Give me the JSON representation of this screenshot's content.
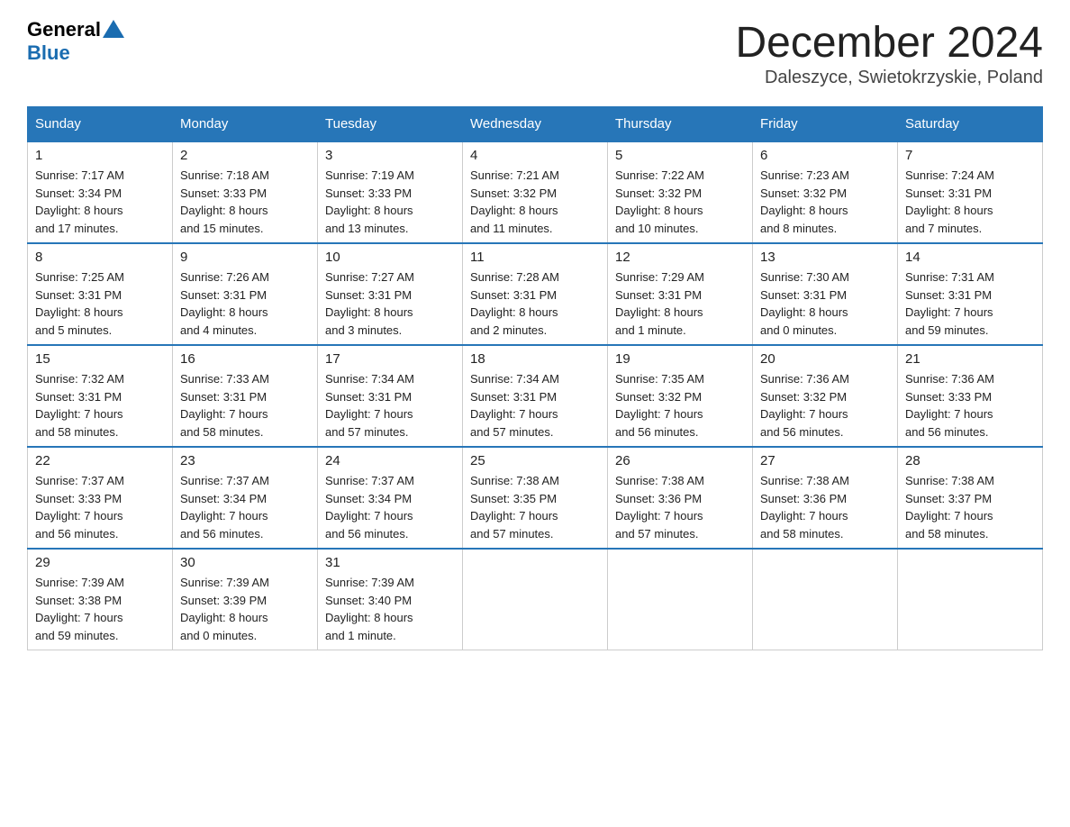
{
  "header": {
    "logo_general": "General",
    "logo_blue": "Blue",
    "title": "December 2024",
    "subtitle": "Daleszyce, Swietokrzyskie, Poland"
  },
  "weekdays": [
    "Sunday",
    "Monday",
    "Tuesday",
    "Wednesday",
    "Thursday",
    "Friday",
    "Saturday"
  ],
  "weeks": [
    [
      {
        "day": "1",
        "info": "Sunrise: 7:17 AM\nSunset: 3:34 PM\nDaylight: 8 hours\nand 17 minutes."
      },
      {
        "day": "2",
        "info": "Sunrise: 7:18 AM\nSunset: 3:33 PM\nDaylight: 8 hours\nand 15 minutes."
      },
      {
        "day": "3",
        "info": "Sunrise: 7:19 AM\nSunset: 3:33 PM\nDaylight: 8 hours\nand 13 minutes."
      },
      {
        "day": "4",
        "info": "Sunrise: 7:21 AM\nSunset: 3:32 PM\nDaylight: 8 hours\nand 11 minutes."
      },
      {
        "day": "5",
        "info": "Sunrise: 7:22 AM\nSunset: 3:32 PM\nDaylight: 8 hours\nand 10 minutes."
      },
      {
        "day": "6",
        "info": "Sunrise: 7:23 AM\nSunset: 3:32 PM\nDaylight: 8 hours\nand 8 minutes."
      },
      {
        "day": "7",
        "info": "Sunrise: 7:24 AM\nSunset: 3:31 PM\nDaylight: 8 hours\nand 7 minutes."
      }
    ],
    [
      {
        "day": "8",
        "info": "Sunrise: 7:25 AM\nSunset: 3:31 PM\nDaylight: 8 hours\nand 5 minutes."
      },
      {
        "day": "9",
        "info": "Sunrise: 7:26 AM\nSunset: 3:31 PM\nDaylight: 8 hours\nand 4 minutes."
      },
      {
        "day": "10",
        "info": "Sunrise: 7:27 AM\nSunset: 3:31 PM\nDaylight: 8 hours\nand 3 minutes."
      },
      {
        "day": "11",
        "info": "Sunrise: 7:28 AM\nSunset: 3:31 PM\nDaylight: 8 hours\nand 2 minutes."
      },
      {
        "day": "12",
        "info": "Sunrise: 7:29 AM\nSunset: 3:31 PM\nDaylight: 8 hours\nand 1 minute."
      },
      {
        "day": "13",
        "info": "Sunrise: 7:30 AM\nSunset: 3:31 PM\nDaylight: 8 hours\nand 0 minutes."
      },
      {
        "day": "14",
        "info": "Sunrise: 7:31 AM\nSunset: 3:31 PM\nDaylight: 7 hours\nand 59 minutes."
      }
    ],
    [
      {
        "day": "15",
        "info": "Sunrise: 7:32 AM\nSunset: 3:31 PM\nDaylight: 7 hours\nand 58 minutes."
      },
      {
        "day": "16",
        "info": "Sunrise: 7:33 AM\nSunset: 3:31 PM\nDaylight: 7 hours\nand 58 minutes."
      },
      {
        "day": "17",
        "info": "Sunrise: 7:34 AM\nSunset: 3:31 PM\nDaylight: 7 hours\nand 57 minutes."
      },
      {
        "day": "18",
        "info": "Sunrise: 7:34 AM\nSunset: 3:31 PM\nDaylight: 7 hours\nand 57 minutes."
      },
      {
        "day": "19",
        "info": "Sunrise: 7:35 AM\nSunset: 3:32 PM\nDaylight: 7 hours\nand 56 minutes."
      },
      {
        "day": "20",
        "info": "Sunrise: 7:36 AM\nSunset: 3:32 PM\nDaylight: 7 hours\nand 56 minutes."
      },
      {
        "day": "21",
        "info": "Sunrise: 7:36 AM\nSunset: 3:33 PM\nDaylight: 7 hours\nand 56 minutes."
      }
    ],
    [
      {
        "day": "22",
        "info": "Sunrise: 7:37 AM\nSunset: 3:33 PM\nDaylight: 7 hours\nand 56 minutes."
      },
      {
        "day": "23",
        "info": "Sunrise: 7:37 AM\nSunset: 3:34 PM\nDaylight: 7 hours\nand 56 minutes."
      },
      {
        "day": "24",
        "info": "Sunrise: 7:37 AM\nSunset: 3:34 PM\nDaylight: 7 hours\nand 56 minutes."
      },
      {
        "day": "25",
        "info": "Sunrise: 7:38 AM\nSunset: 3:35 PM\nDaylight: 7 hours\nand 57 minutes."
      },
      {
        "day": "26",
        "info": "Sunrise: 7:38 AM\nSunset: 3:36 PM\nDaylight: 7 hours\nand 57 minutes."
      },
      {
        "day": "27",
        "info": "Sunrise: 7:38 AM\nSunset: 3:36 PM\nDaylight: 7 hours\nand 58 minutes."
      },
      {
        "day": "28",
        "info": "Sunrise: 7:38 AM\nSunset: 3:37 PM\nDaylight: 7 hours\nand 58 minutes."
      }
    ],
    [
      {
        "day": "29",
        "info": "Sunrise: 7:39 AM\nSunset: 3:38 PM\nDaylight: 7 hours\nand 59 minutes."
      },
      {
        "day": "30",
        "info": "Sunrise: 7:39 AM\nSunset: 3:39 PM\nDaylight: 8 hours\nand 0 minutes."
      },
      {
        "day": "31",
        "info": "Sunrise: 7:39 AM\nSunset: 3:40 PM\nDaylight: 8 hours\nand 1 minute."
      },
      null,
      null,
      null,
      null
    ]
  ]
}
